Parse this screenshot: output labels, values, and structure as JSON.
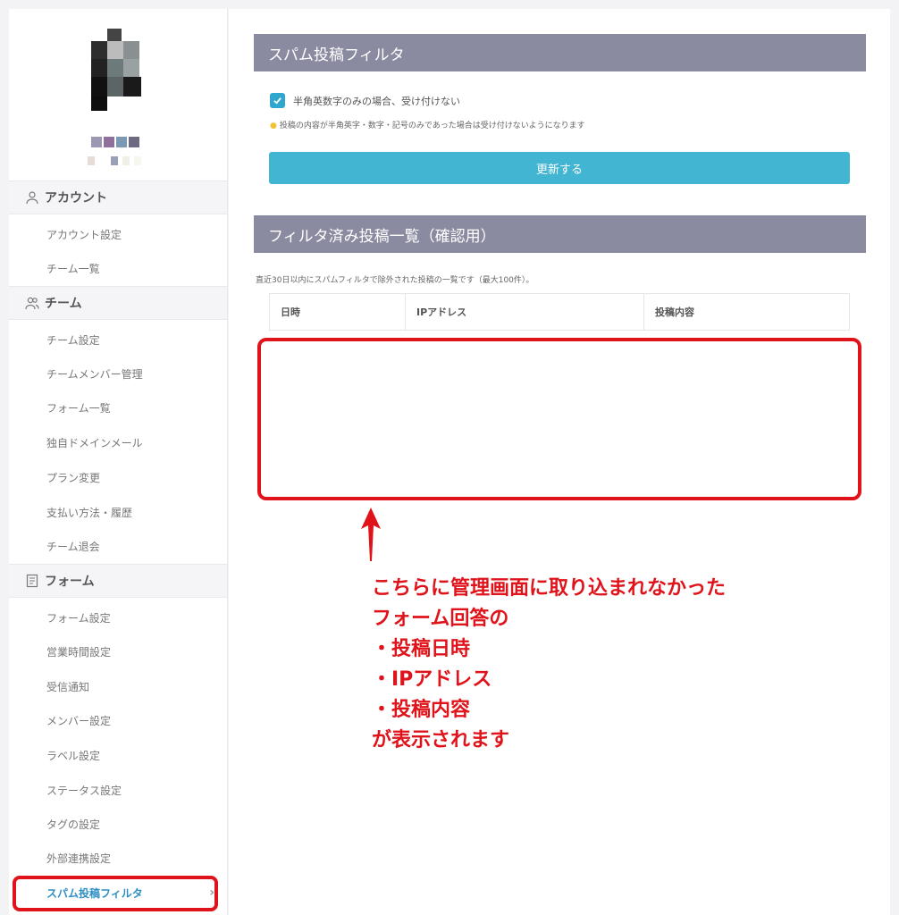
{
  "sidebar": {
    "sections": [
      {
        "label": "アカウント",
        "icon": "user-icon",
        "items": [
          {
            "label": "アカウント設定"
          },
          {
            "label": "チーム一覧"
          }
        ]
      },
      {
        "label": "チーム",
        "icon": "users-icon",
        "items": [
          {
            "label": "チーム設定"
          },
          {
            "label": "チームメンバー管理"
          },
          {
            "label": "フォーム一覧"
          },
          {
            "label": "独自ドメインメール"
          },
          {
            "label": "プラン変更"
          },
          {
            "label": "支払い方法・履歴"
          },
          {
            "label": "チーム退会"
          }
        ]
      },
      {
        "label": "フォーム",
        "icon": "document-icon",
        "items": [
          {
            "label": "フォーム設定"
          },
          {
            "label": "営業時間設定"
          },
          {
            "label": "受信通知"
          },
          {
            "label": "メンバー設定"
          },
          {
            "label": "ラベル設定"
          },
          {
            "label": "ステータス設定"
          },
          {
            "label": "タグの設定"
          },
          {
            "label": "外部連携設定"
          },
          {
            "label": "スパム投稿フィルタ",
            "active": true
          }
        ]
      }
    ]
  },
  "main": {
    "spam_filter": {
      "title": "スパム投稿フィルタ",
      "checkbox_label": "半角英数字のみの場合、受け付けない",
      "checked": true,
      "hint": "投稿の内容が半角英字・数字・記号のみであった場合は受け付けないようになります",
      "update_button": "更新する"
    },
    "filtered_list": {
      "title": "フィルタ済み投稿一覧（確認用）",
      "description": "直近30日以内にスパムフィルタで除外された投稿の一覧です（最大100件）。",
      "columns": [
        "日時",
        "IPアドレス",
        "投稿内容"
      ]
    }
  },
  "annotation": {
    "lines": [
      "こちらに管理画面に取り込まれなかった",
      "フォーム回答の",
      "・投稿日時",
      "・IPアドレス",
      "・投稿内容",
      "が表示されます"
    ]
  },
  "colors": {
    "accent": "#41b5d1",
    "header": "#8a8aa0",
    "annotation": "#e0131b"
  }
}
